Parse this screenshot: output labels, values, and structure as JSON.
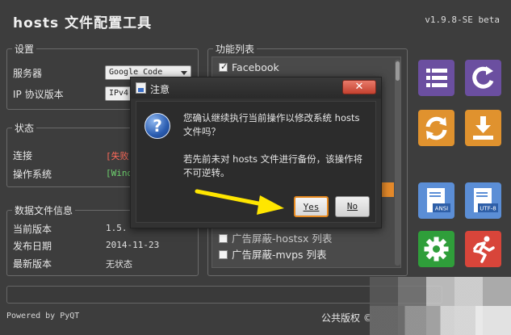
{
  "app": {
    "title": "hosts 文件配置工具",
    "version": "v1.9.8-SE beta"
  },
  "settings": {
    "legend": "设置",
    "server_label": "服务器",
    "server_value": "Google Code",
    "ip_label": "IP 协议版本",
    "ip_value": "IPv4"
  },
  "status": {
    "legend": "状态",
    "connection_label": "连接",
    "connection_value": "[失败]",
    "os_label": "操作系统",
    "os_value": "[Windows]"
  },
  "data_info": {
    "legend": "数据文件信息",
    "current_version_label": "当前版本",
    "current_version_value": "1.5.",
    "release_date_label": "发布日期",
    "release_date_value": "2014-11-23",
    "latest_version_label": "最新版本",
    "latest_version_value": "无状态"
  },
  "functions": {
    "legend": "功能列表",
    "items": [
      {
        "label": "Facebook",
        "checked": true
      },
      {
        "label": "广告屏蔽-hostsx 列表",
        "checked": false
      },
      {
        "label": "广告屏蔽-mvps 列表",
        "checked": false
      }
    ]
  },
  "tiles": [
    {
      "icon": "list-icon",
      "color": "#6b4fa0"
    },
    {
      "icon": "refresh-icon",
      "color": "#6b4fa0"
    },
    {
      "icon": "sync-icon",
      "color": "#e0922e"
    },
    {
      "icon": "download-icon",
      "color": "#e0922e"
    },
    {
      "icon": "ansi-file-icon",
      "color": "#5b8ed6"
    },
    {
      "icon": "utf8-file-icon",
      "color": "#5b8ed6"
    },
    {
      "icon": "gear-icon",
      "color": "#2f9e3a"
    },
    {
      "icon": "exit-runner-icon",
      "color": "#d8453a"
    }
  ],
  "footer": {
    "powered_by": "Powered by PyQT",
    "copyright": "公共版权 ©"
  },
  "dialog": {
    "title": "注意",
    "close_label": "✕",
    "message_line1": "您确认继续执行当前操作以修改系统 hosts",
    "message_line2": "文件吗？",
    "message_line3": "若先前未对 hosts 文件进行备份，该操作将",
    "message_line4": "不可逆转。",
    "yes_label": "Yes",
    "no_label": "No"
  }
}
